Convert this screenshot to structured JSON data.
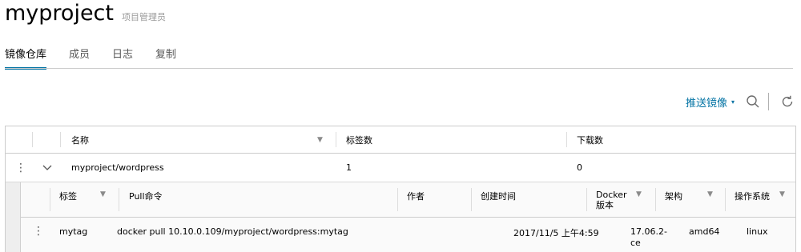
{
  "project": {
    "name": "myproject",
    "role": "项目管理员"
  },
  "tabs": [
    "镜像仓库",
    "成员",
    "日志",
    "复制"
  ],
  "toolbar": {
    "push_label": "推送镜像"
  },
  "repo_table": {
    "headers": {
      "name": "名称",
      "tags": "标签数",
      "downloads": "下载数"
    },
    "rows": [
      {
        "name": "myproject/wordpress",
        "tags": "1",
        "downloads": "0"
      }
    ]
  },
  "tag_table": {
    "headers": {
      "tag": "标签",
      "pull": "Pull命令",
      "author": "作者",
      "created": "创建时间",
      "docker": "Docker 版本",
      "arch": "架构",
      "os": "操作系统"
    },
    "rows": [
      {
        "tag": "mytag",
        "pull": "docker pull 10.10.0.109/myproject/wordpress:mytag",
        "author": "",
        "created": "2017/11/5 上午4:59",
        "docker": "17.06.2-ce",
        "arch": "amd64",
        "os": "linux"
      }
    ]
  },
  "colors": {
    "accent": "#0072a3",
    "border": "#cccccc"
  }
}
